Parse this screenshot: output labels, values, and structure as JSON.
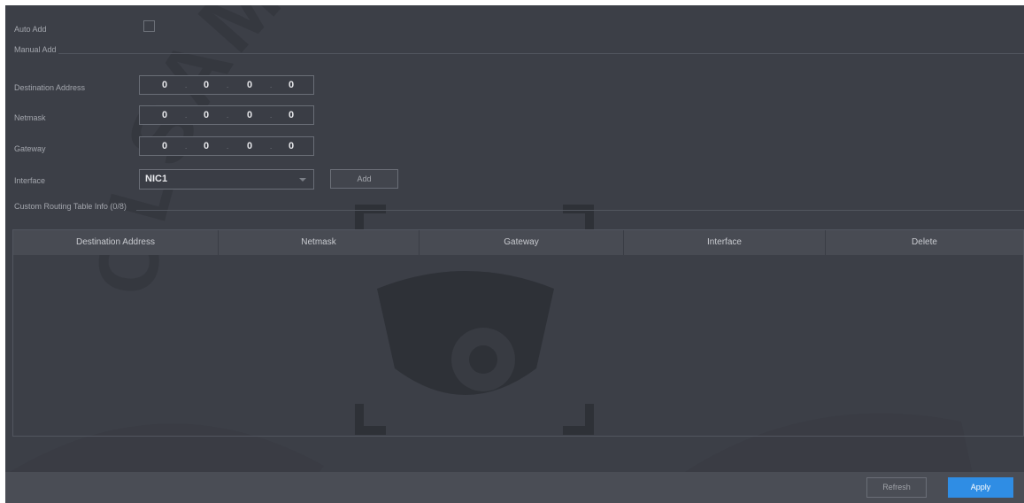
{
  "auto_add": {
    "label": "Auto Add",
    "checked": false
  },
  "manual_add": {
    "title": "Manual Add"
  },
  "fields": {
    "destination": {
      "label": "Destination Address",
      "octets": [
        "0",
        "0",
        "0",
        "0"
      ]
    },
    "netmask": {
      "label": "Netmask",
      "octets": [
        "0",
        "0",
        "0",
        "0"
      ]
    },
    "gateway": {
      "label": "Gateway",
      "octets": [
        "0",
        "0",
        "0",
        "0"
      ]
    },
    "interface": {
      "label": "Interface",
      "value": "NIC1"
    }
  },
  "add_button": "Add",
  "routing_table": {
    "title": "Custom Routing Table Info (0/8)",
    "columns": [
      "Destination Address",
      "Netmask",
      "Gateway",
      "Interface",
      "Delete"
    ],
    "rows": []
  },
  "footer": {
    "refresh": "Refresh",
    "apply": "Apply"
  },
  "watermark": {
    "text": "OLSAM SECURITY"
  },
  "colors": {
    "background": "#3c3f47",
    "accent": "#2f8de4"
  }
}
